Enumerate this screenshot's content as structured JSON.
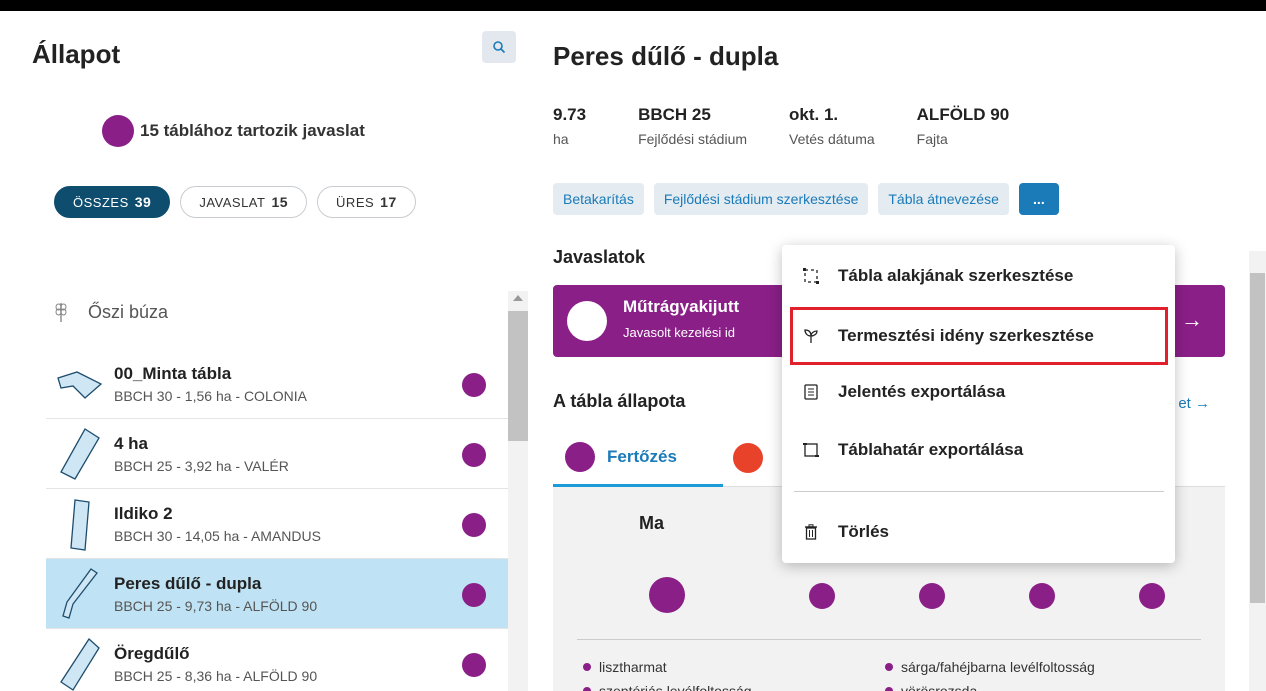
{
  "left": {
    "title": "Állapot",
    "summary": "15 táblához tartozik javaslat",
    "filters": [
      {
        "label": "ÖSSZES",
        "count": "39"
      },
      {
        "label": "JAVASLAT",
        "count": "15"
      },
      {
        "label": "ÜRES",
        "count": "17"
      }
    ],
    "crop": "Őszi búza",
    "fields": [
      {
        "name": "00_Minta tábla",
        "sub": "BBCH 30 - 1,56 ha - COLONIA"
      },
      {
        "name": "4 ha",
        "sub": "BBCH 25 - 3,92 ha - VALÉR"
      },
      {
        "name": "Ildiko 2",
        "sub": "BBCH 30 - 14,05 ha - AMANDUS"
      },
      {
        "name": "Peres dűlő - dupla",
        "sub": "BBCH 25 - 9,73 ha - ALFÖLD 90"
      },
      {
        "name": "Öregdűlő",
        "sub": "BBCH 25 - 8,36 ha - ALFÖLD 90"
      }
    ]
  },
  "right": {
    "title": "Peres dűlő - dupla",
    "stats": [
      {
        "value": "9.73",
        "label": "ha"
      },
      {
        "value": "BBCH 25",
        "label": "Fejlődési stádium"
      },
      {
        "value": "okt. 1.",
        "label": "Vetés dátuma"
      },
      {
        "value": "ALFÖLD 90",
        "label": "Fajta"
      }
    ],
    "actions": [
      "Betakarítás",
      "Fejlődési stádium szerkesztése",
      "Tábla átnevezése",
      "..."
    ],
    "recommendations_title": "Javaslatok",
    "banner_title": "Műtrágyakijutt",
    "banner_sub": "Javasolt kezelési id",
    "status_title": "A tábla állapota",
    "status_link": "et →",
    "tab_label": "Fertőzés",
    "today": "Ma",
    "legend": [
      "lisztharmat",
      "sárga/fahéjbarna levélfoltosság",
      "szeptóriás levélfoltosság",
      "vörösrozsda"
    ]
  },
  "menu": {
    "items": [
      {
        "label": "Tábla alakjának szerkesztése",
        "icon": "shape-edit-icon"
      },
      {
        "label": "Termesztési idény szerkesztése",
        "icon": "sprout-icon"
      },
      {
        "label": "Jelentés exportálása",
        "icon": "document-icon"
      },
      {
        "label": "Táblahatár exportálása",
        "icon": "boundary-export-icon"
      },
      {
        "label": "Törlés",
        "icon": "trash-icon"
      }
    ]
  },
  "colors": {
    "accent": "#1b7bb8",
    "purple": "#8a1f87",
    "navy": "#0f4d6e",
    "selected_row": "#bfe3f4",
    "highlight": "#e0202a"
  }
}
